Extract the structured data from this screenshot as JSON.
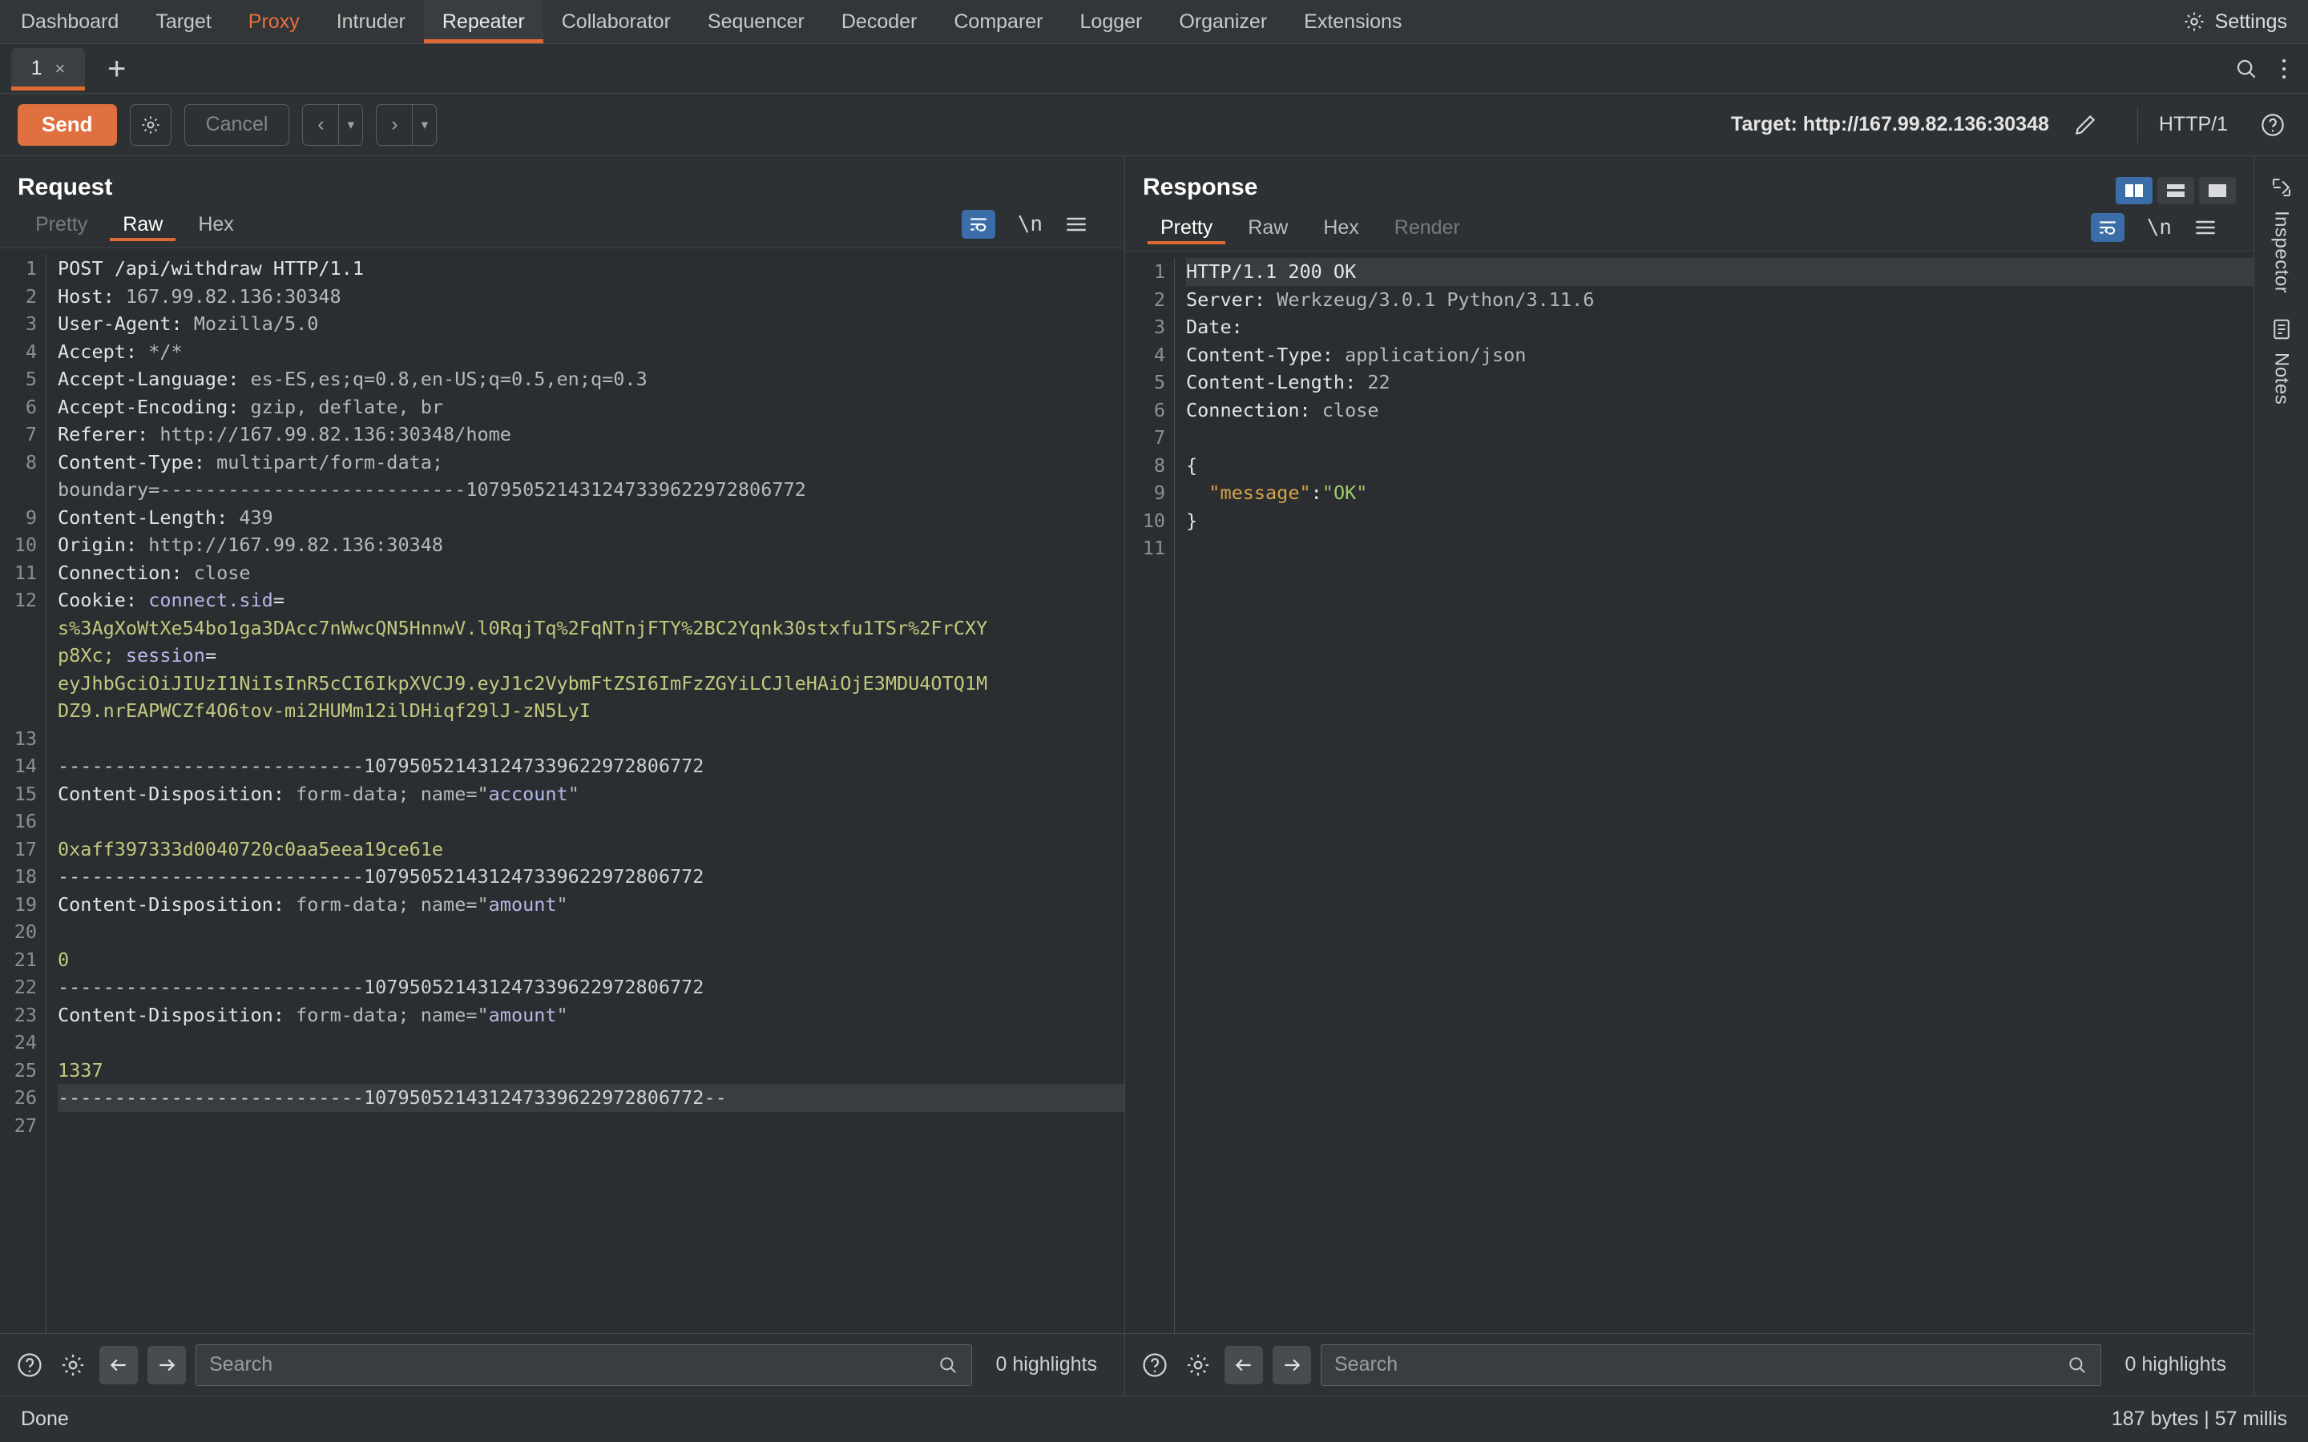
{
  "menubar": {
    "items": [
      {
        "label": "Dashboard",
        "state": "normal"
      },
      {
        "label": "Target",
        "state": "normal"
      },
      {
        "label": "Proxy",
        "state": "accent"
      },
      {
        "label": "Intruder",
        "state": "normal"
      },
      {
        "label": "Repeater",
        "state": "active"
      },
      {
        "label": "Collaborator",
        "state": "normal"
      },
      {
        "label": "Sequencer",
        "state": "normal"
      },
      {
        "label": "Decoder",
        "state": "normal"
      },
      {
        "label": "Comparer",
        "state": "normal"
      },
      {
        "label": "Logger",
        "state": "normal"
      },
      {
        "label": "Organizer",
        "state": "normal"
      },
      {
        "label": "Extensions",
        "state": "normal"
      }
    ],
    "settings_label": "Settings",
    "settings_icon": "gear-icon",
    "accent_color": "#e8703a",
    "active_underline_color": "#e06a33"
  },
  "tabstrip": {
    "tab_label": "1",
    "tab_close": "×",
    "add_label": "+",
    "search_icon": "search-icon",
    "menu_icon": "vertical-dots-icon"
  },
  "toolbar": {
    "send_label": "Send",
    "settings_icon": "gear-icon",
    "cancel_label": "Cancel",
    "back_arrow": "‹",
    "forward_arrow": "›",
    "caret": "▾",
    "target_label": "Target: http://167.99.82.136:30348",
    "edit_icon": "pencil-icon",
    "http_version": "HTTP/1",
    "help_icon": "help-circle-icon"
  },
  "request": {
    "title": "Request",
    "tabs": [
      {
        "label": "Pretty",
        "state": "dim"
      },
      {
        "label": "Raw",
        "state": "active"
      },
      {
        "label": "Hex",
        "state": "normal"
      }
    ],
    "wrap_icon": "word-wrap-icon",
    "newline_label": "\\n",
    "menu_icon": "hamburger-icon",
    "lines": [
      {
        "n": "1",
        "segments": [
          {
            "t": "POST /api/withdraw HTTP/1.1",
            "c": "k"
          }
        ]
      },
      {
        "n": "2",
        "segments": [
          {
            "t": "Host: ",
            "c": "k"
          },
          {
            "t": "167.99.82.136:30348",
            "c": "v"
          }
        ]
      },
      {
        "n": "3",
        "segments": [
          {
            "t": "User-Agent: ",
            "c": "k"
          },
          {
            "t": "Mozilla/5.0",
            "c": "v"
          }
        ]
      },
      {
        "n": "4",
        "segments": [
          {
            "t": "Accept: ",
            "c": "k"
          },
          {
            "t": "*/*",
            "c": "v"
          }
        ]
      },
      {
        "n": "5",
        "segments": [
          {
            "t": "Accept-Language: ",
            "c": "k"
          },
          {
            "t": "es-ES,es;q=0.8,en-US;q=0.5,en;q=0.3",
            "c": "v"
          }
        ]
      },
      {
        "n": "6",
        "segments": [
          {
            "t": "Accept-Encoding: ",
            "c": "k"
          },
          {
            "t": "gzip, deflate, br",
            "c": "v"
          }
        ]
      },
      {
        "n": "7",
        "segments": [
          {
            "t": "Referer: ",
            "c": "k"
          },
          {
            "t": "http://167.99.82.136:30348/home",
            "c": "v"
          }
        ]
      },
      {
        "n": "8",
        "segments": [
          {
            "t": "Content-Type: ",
            "c": "k"
          },
          {
            "t": "multipart/form-data;",
            "c": "v"
          }
        ]
      },
      {
        "n": "",
        "segments": [
          {
            "t": "boundary=",
            "c": "v"
          },
          {
            "t": "---------------------------107950521431247339622972806772",
            "c": "v"
          }
        ]
      },
      {
        "n": "9",
        "segments": [
          {
            "t": "Content-Length: ",
            "c": "k"
          },
          {
            "t": "439",
            "c": "v"
          }
        ]
      },
      {
        "n": "10",
        "segments": [
          {
            "t": "Origin: ",
            "c": "k"
          },
          {
            "t": "http://167.99.82.136:30348",
            "c": "v"
          }
        ]
      },
      {
        "n": "11",
        "segments": [
          {
            "t": "Connection: ",
            "c": "k"
          },
          {
            "t": "close",
            "c": "v"
          }
        ]
      },
      {
        "n": "12",
        "segments": [
          {
            "t": "Cookie: ",
            "c": "k"
          },
          {
            "t": "connect.sid",
            "c": "strb"
          },
          {
            "t": "=",
            "c": "k"
          }
        ]
      },
      {
        "n": "",
        "segments": [
          {
            "t": "s%3AgXoWtXe54bo1ga3DAcc7nWwcQN5HnnwV.l0RqjTq%2FqNTnjFTY%2BC2Yqnk30stxfu1TSr%2FrCXY",
            "c": "cookieval"
          }
        ]
      },
      {
        "n": "",
        "segments": [
          {
            "t": "p8Xc; ",
            "c": "cookieval"
          },
          {
            "t": "session",
            "c": "strb"
          },
          {
            "t": "=",
            "c": "k"
          }
        ]
      },
      {
        "n": "",
        "segments": [
          {
            "t": "eyJhbGciOiJIUzI1NiIsInR5cCI6IkpXVCJ9.eyJ1c2VybmFtZSI6ImFzZGYiLCJleHAiOjE3MDU4OTQ1M",
            "c": "cookieval"
          }
        ]
      },
      {
        "n": "",
        "segments": [
          {
            "t": "DZ9.nrEAPWCZf4O6tov-mi2HUMm12ilDHiqf29lJ-zN5LyI",
            "c": "cookieval"
          }
        ]
      },
      {
        "n": "13",
        "segments": [
          {
            "t": "",
            "c": "k"
          }
        ]
      },
      {
        "n": "14",
        "segments": [
          {
            "t": "---------------------------107950521431247339622972806772",
            "c": "boundary"
          }
        ]
      },
      {
        "n": "15",
        "segments": [
          {
            "t": "Content-Disposition: ",
            "c": "k"
          },
          {
            "t": "form-data; name=",
            "c": "v"
          },
          {
            "t": "\"",
            "c": "v"
          },
          {
            "t": "account",
            "c": "strb"
          },
          {
            "t": "\"",
            "c": "v"
          }
        ]
      },
      {
        "n": "16",
        "segments": [
          {
            "t": "",
            "c": "k"
          }
        ]
      },
      {
        "n": "17",
        "segments": [
          {
            "t": "0xaff397333d0040720c0aa5eea19ce61e",
            "c": "cookieval"
          }
        ]
      },
      {
        "n": "18",
        "segments": [
          {
            "t": "---------------------------107950521431247339622972806772",
            "c": "boundary"
          }
        ]
      },
      {
        "n": "19",
        "segments": [
          {
            "t": "Content-Disposition: ",
            "c": "k"
          },
          {
            "t": "form-data; name=",
            "c": "v"
          },
          {
            "t": "\"",
            "c": "v"
          },
          {
            "t": "amount",
            "c": "strb"
          },
          {
            "t": "\"",
            "c": "v"
          }
        ]
      },
      {
        "n": "20",
        "segments": [
          {
            "t": "",
            "c": "k"
          }
        ]
      },
      {
        "n": "21",
        "segments": [
          {
            "t": "0",
            "c": "cookieval"
          }
        ]
      },
      {
        "n": "22",
        "segments": [
          {
            "t": "---------------------------107950521431247339622972806772",
            "c": "boundary"
          }
        ]
      },
      {
        "n": "23",
        "segments": [
          {
            "t": "Content-Disposition: ",
            "c": "k"
          },
          {
            "t": "form-data; name=",
            "c": "v"
          },
          {
            "t": "\"",
            "c": "v"
          },
          {
            "t": "amount",
            "c": "strb"
          },
          {
            "t": "\"",
            "c": "v"
          }
        ]
      },
      {
        "n": "24",
        "segments": [
          {
            "t": "",
            "c": "k"
          }
        ]
      },
      {
        "n": "25",
        "segments": [
          {
            "t": "1337",
            "c": "cookieval"
          }
        ]
      },
      {
        "n": "26",
        "segments": [
          {
            "t": "---------------------------107950521431247339622972806772--",
            "c": "boundary"
          }
        ],
        "selected": true
      },
      {
        "n": "27",
        "segments": [
          {
            "t": "",
            "c": "k"
          }
        ]
      }
    ],
    "footer": {
      "help_icon": "help-circle-icon",
      "settings_icon": "gear-icon",
      "back_icon": "arrow-left-icon",
      "forward_icon": "arrow-right-icon",
      "search_placeholder": "Search",
      "search_value": "",
      "search_icon": "search-icon",
      "highlights": "0 highlights"
    }
  },
  "response": {
    "title": "Response",
    "tabs": [
      {
        "label": "Pretty",
        "state": "active"
      },
      {
        "label": "Raw",
        "state": "normal"
      },
      {
        "label": "Hex",
        "state": "normal"
      },
      {
        "label": "Render",
        "state": "dim"
      }
    ],
    "wrap_icon": "word-wrap-icon",
    "newline_label": "\\n",
    "menu_icon": "hamburger-icon",
    "layout_buttons": [
      "split-vertical-icon",
      "split-horizontal-icon",
      "single-pane-icon"
    ],
    "lines": [
      {
        "n": "1",
        "segments": [
          {
            "t": "HTTP/1.1 200 OK",
            "c": "k"
          }
        ],
        "selected": true
      },
      {
        "n": "2",
        "segments": [
          {
            "t": "Server: ",
            "c": "k"
          },
          {
            "t": "Werkzeug/3.0.1 Python/3.11.6",
            "c": "v"
          }
        ]
      },
      {
        "n": "3",
        "segments": [
          {
            "t": "Date:",
            "c": "k"
          }
        ]
      },
      {
        "n": "4",
        "segments": [
          {
            "t": "Content-Type: ",
            "c": "k"
          },
          {
            "t": "application/json",
            "c": "v"
          }
        ]
      },
      {
        "n": "5",
        "segments": [
          {
            "t": "Content-Length: ",
            "c": "k"
          },
          {
            "t": "22",
            "c": "v"
          }
        ]
      },
      {
        "n": "6",
        "segments": [
          {
            "t": "Connection: ",
            "c": "k"
          },
          {
            "t": "close",
            "c": "v"
          }
        ]
      },
      {
        "n": "7",
        "segments": [
          {
            "t": "",
            "c": "k"
          }
        ]
      },
      {
        "n": "8",
        "segments": [
          {
            "t": "{",
            "c": "k"
          }
        ]
      },
      {
        "n": "9",
        "segments": [
          {
            "t": "  ",
            "c": "k"
          },
          {
            "t": "\"message\"",
            "c": "jkey"
          },
          {
            "t": ":",
            "c": "k"
          },
          {
            "t": "\"OK\"",
            "c": "jval"
          }
        ]
      },
      {
        "n": "10",
        "segments": [
          {
            "t": "}",
            "c": "k"
          }
        ]
      },
      {
        "n": "11",
        "segments": [
          {
            "t": "",
            "c": "k"
          }
        ]
      }
    ],
    "footer": {
      "help_icon": "help-circle-icon",
      "settings_icon": "gear-icon",
      "back_icon": "arrow-left-icon",
      "forward_icon": "arrow-right-icon",
      "search_placeholder": "Search",
      "search_value": "",
      "search_icon": "search-icon",
      "highlights": "0 highlights"
    }
  },
  "rail": {
    "items": [
      {
        "label": "Inspector",
        "icon": "inspector-icon"
      },
      {
        "label": "Notes",
        "icon": "notes-icon"
      }
    ]
  },
  "statusbar": {
    "left": "Done",
    "right": "187 bytes | 57 millis"
  }
}
